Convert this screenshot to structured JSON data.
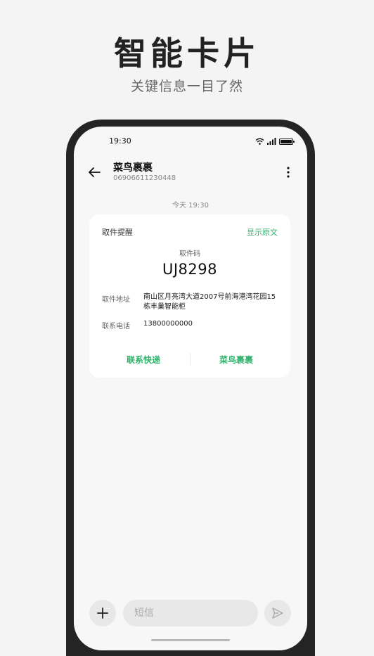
{
  "hero": {
    "title": "智能卡片",
    "subtitle": "关键信息一目了然"
  },
  "status_bar": {
    "time": "19:30",
    "icons": [
      "wifi-icon",
      "signal-icon",
      "battery-icon"
    ]
  },
  "header": {
    "back_icon": "arrow-left-icon",
    "contact_name": "菜鸟裹裹",
    "contact_number": "06906611230448",
    "more_icon": "more-vertical-icon"
  },
  "message_time": "今天 19:30",
  "card": {
    "title": "取件提醒",
    "show_original": "显示原文",
    "code_label": "取件码",
    "code_value": "UJ8298",
    "address_label": "取件地址",
    "address_value": "南山区月亮湾大道2007号前海港湾花园15栋丰巢智能柜",
    "phone_label": "联系电话",
    "phone_value": "13800000000",
    "action_contact": "联系快递",
    "action_app": "菜鸟裹裹"
  },
  "composer": {
    "add_icon": "plus-icon",
    "placeholder": "短信",
    "send_icon": "send-icon"
  },
  "colors": {
    "accent": "#2fb26b",
    "phone_frame": "#242424",
    "background": "#f4f4f4"
  }
}
